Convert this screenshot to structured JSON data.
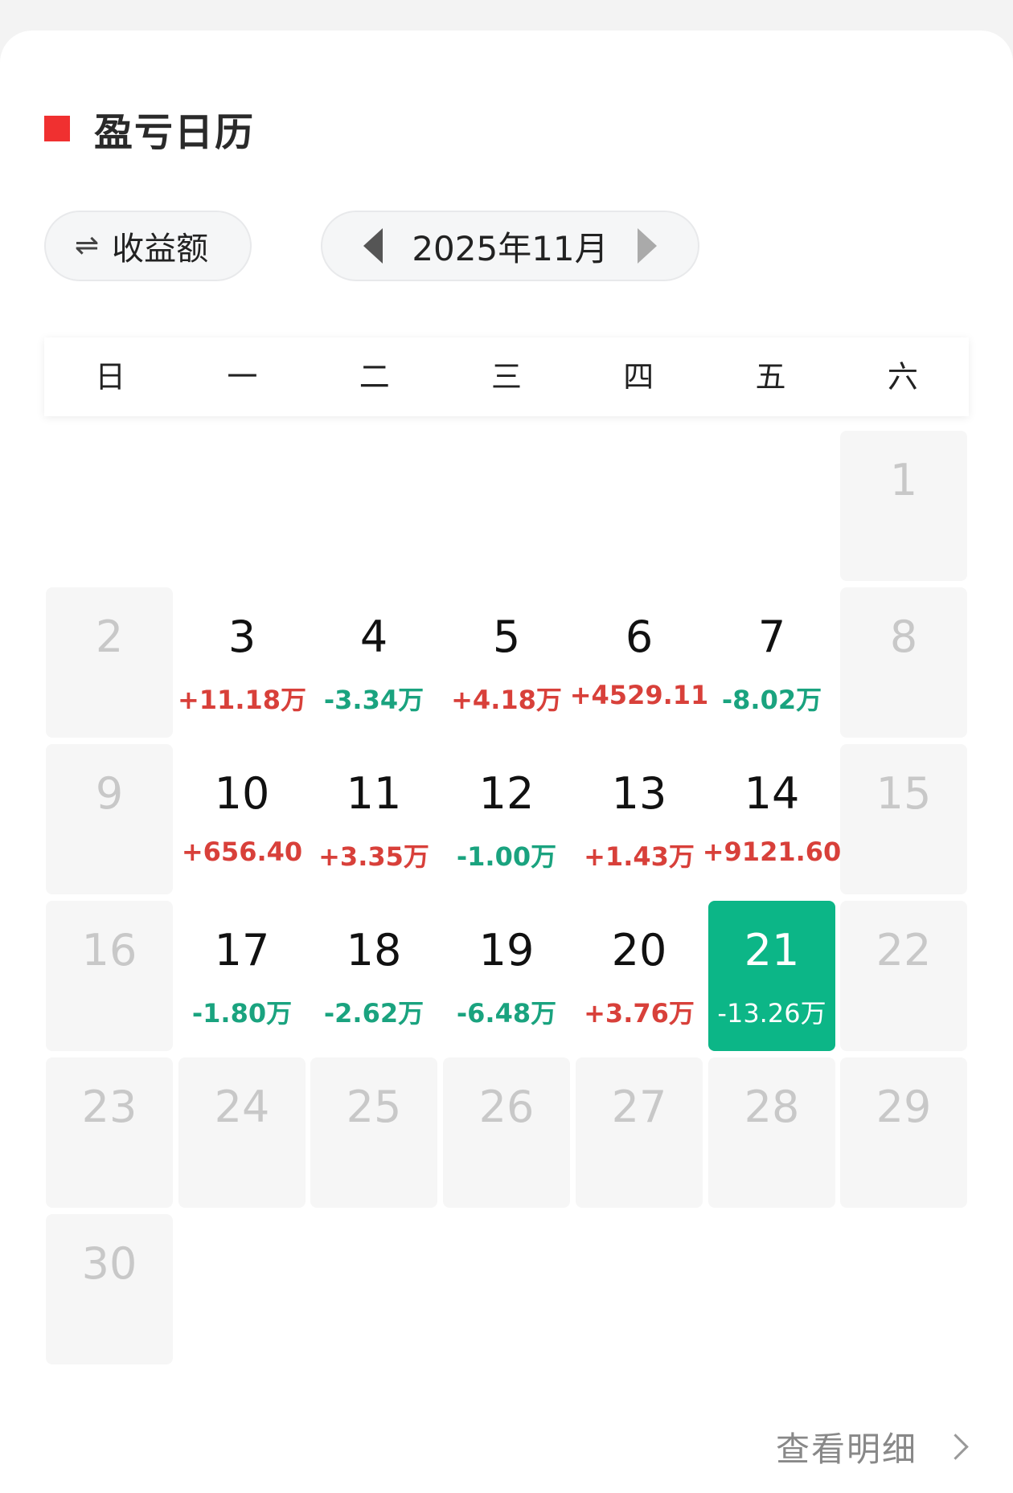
{
  "title": "盈亏日历",
  "metric_toggle": {
    "icon": "swap-arrows-icon",
    "label": "收益额"
  },
  "month_nav": {
    "label": "2025年11月"
  },
  "weekdays": [
    "日",
    "一",
    "二",
    "三",
    "四",
    "五",
    "六"
  ],
  "days": {
    "1": {
      "day": "1",
      "value": ""
    },
    "2": {
      "day": "2",
      "value": ""
    },
    "3": {
      "day": "3",
      "value": "+11.18万"
    },
    "4": {
      "day": "4",
      "value": "-3.34万"
    },
    "5": {
      "day": "5",
      "value": "+4.18万"
    },
    "6": {
      "day": "6",
      "value": "+4529.11"
    },
    "7": {
      "day": "7",
      "value": "-8.02万"
    },
    "8": {
      "day": "8",
      "value": ""
    },
    "9": {
      "day": "9",
      "value": ""
    },
    "10": {
      "day": "10",
      "value": "+656.40"
    },
    "11": {
      "day": "11",
      "value": "+3.35万"
    },
    "12": {
      "day": "12",
      "value": "-1.00万"
    },
    "13": {
      "day": "13",
      "value": "+1.43万"
    },
    "14": {
      "day": "14",
      "value": "+9121.60"
    },
    "15": {
      "day": "15",
      "value": ""
    },
    "16": {
      "day": "16",
      "value": ""
    },
    "17": {
      "day": "17",
      "value": "-1.80万"
    },
    "18": {
      "day": "18",
      "value": "-2.62万"
    },
    "19": {
      "day": "19",
      "value": "-6.48万"
    },
    "20": {
      "day": "20",
      "value": "+3.76万"
    },
    "21": {
      "day": "21",
      "value": "-13.26万"
    },
    "22": {
      "day": "22",
      "value": ""
    },
    "23": {
      "day": "23",
      "value": ""
    },
    "24": {
      "day": "24",
      "value": ""
    },
    "25": {
      "day": "25",
      "value": ""
    },
    "26": {
      "day": "26",
      "value": ""
    },
    "27": {
      "day": "27",
      "value": ""
    },
    "28": {
      "day": "28",
      "value": ""
    },
    "29": {
      "day": "29",
      "value": ""
    },
    "30": {
      "day": "30",
      "value": ""
    }
  },
  "selected_day": "21",
  "footer": {
    "detail_label": "查看明细"
  },
  "colors": {
    "accent": "#f03030",
    "profit": "#d8403a",
    "loss": "#1aa37f",
    "selected": "#0cb687"
  }
}
